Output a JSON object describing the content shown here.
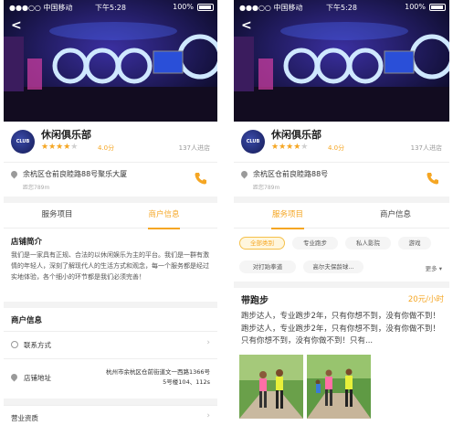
{
  "status": {
    "carrier": "●●●○○ 中国移动",
    "time": "下午5:28",
    "battery": "100%"
  },
  "venue": {
    "name": "休闲俱乐部",
    "logo_text": "CLUB",
    "rating": 4,
    "rating_max": 5,
    "score": "4.0分",
    "visitors": "137人进店",
    "address": "余杭区仓前良睦路88号聚乐大厦",
    "address_short": "余杭区仓前良睦路88号",
    "distance": "距您789m"
  },
  "left": {
    "tabs": [
      "服务项目",
      "商户信息"
    ],
    "active_tab": 1,
    "intro_title": "店铺简介",
    "intro_text": "我们是一家具有正规、合法的以休闲娱乐为主的平台。我们是一群有激情的年轻人，深刻了解现代人的生活方式和观念，每一个服务都是经过实地体验，各个细小的环节都是我们必须完善！",
    "merchant_title": "商户信息",
    "contact_label": "联系方式",
    "address_label": "店铺地址",
    "address_value_1": "杭州市余杭区仓前街道文一西路1366号",
    "address_value_2": "5号楼104、112s",
    "license_label": "营业资质"
  },
  "right": {
    "tabs": [
      "服务项目",
      "商户信息"
    ],
    "active_tab": 0,
    "chips_row1": [
      "全部类别",
      "专业跑步",
      "私人影院",
      "游戏"
    ],
    "chips_row2": [
      "对打跆拳道",
      "高尔夫保龄球..."
    ],
    "more_label": "更多 ▾",
    "service_title": "带跑步",
    "service_price": "20元/小时",
    "service_desc": "跑步达人，专业跑步2年，只有你想不到，没有你做不到！跑步达人，专业跑步2年，只有你想不到，没有你做不到！只有你想不到，没有你做不到！只有..."
  },
  "colors": {
    "accent": "#f5a623",
    "divider": "#f3f3f3"
  }
}
